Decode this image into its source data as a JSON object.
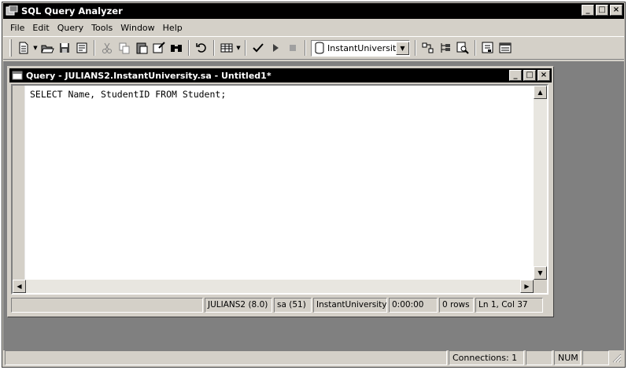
{
  "app": {
    "title": "SQL Query Analyzer"
  },
  "window_buttons": {
    "minimize": "_",
    "restore": "□",
    "close": "×"
  },
  "menu": [
    "File",
    "Edit",
    "Query",
    "Tools",
    "Window",
    "Help"
  ],
  "toolbar": {
    "database_selected": "InstantUniversity",
    "icons": [
      "new-query-icon",
      "open-icon",
      "save-icon",
      "load-script-icon",
      "cut-icon",
      "copy-icon",
      "paste-icon",
      "clear-window-icon",
      "find-icon",
      "undo-icon",
      "results-grid-icon",
      "parse-check-icon",
      "execute-icon",
      "cancel-query-icon",
      "database-icon",
      "execution-plan-icon",
      "object-browser-icon",
      "object-search-icon",
      "options-icon",
      "properties-icon"
    ]
  },
  "query_window": {
    "title": "Query - JULIANS2.InstantUniversity.sa - Untitled1*",
    "code": "SELECT Name, StudentID FROM Student;"
  },
  "query_status": {
    "server": "JULIANS2 (8.0)",
    "user": "sa (51)",
    "database": "InstantUniversity",
    "elapsed": "0:00:00",
    "rows": "0 rows",
    "position": "Ln 1, Col 37"
  },
  "status_bar": {
    "connections": "Connections: 1",
    "num": "NUM"
  }
}
